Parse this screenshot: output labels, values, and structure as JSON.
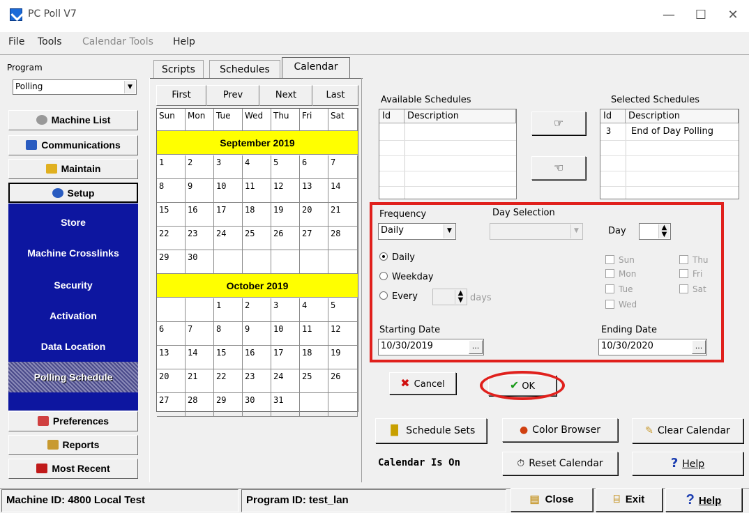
{
  "window": {
    "title": "PC Poll V7"
  },
  "menu": {
    "file": "File",
    "tools": "Tools",
    "calendar_tools": "Calendar Tools",
    "help": "Help"
  },
  "left_panel": {
    "program_label": "Program",
    "program_value": "Polling",
    "nav": {
      "machine_list": "Machine List",
      "communications": "Communications",
      "maintain": "Maintain",
      "setup": "Setup",
      "preferences": "Preferences",
      "reports": "Reports",
      "most_recent": "Most Recent"
    },
    "setup_items": [
      "Store",
      "Machine Crosslinks",
      "Security",
      "Activation",
      "Data Location",
      "Polling Schedule"
    ]
  },
  "tabs": {
    "scripts": "Scripts",
    "schedules": "Schedules",
    "calendar": "Calendar"
  },
  "calendar": {
    "nav": {
      "first": "First",
      "prev": "Prev",
      "next": "Next",
      "last": "Last"
    },
    "days": [
      "Sun",
      "Mon",
      "Tue",
      "Wed",
      "Thu",
      "Fri",
      "Sat"
    ],
    "months": [
      {
        "name": "September 2019",
        "weeks": [
          [
            "1",
            "2",
            "3",
            "4",
            "5",
            "6",
            "7"
          ],
          [
            "8",
            "9",
            "10",
            "11",
            "12",
            "13",
            "14"
          ],
          [
            "15",
            "16",
            "17",
            "18",
            "19",
            "20",
            "21"
          ],
          [
            "22",
            "23",
            "24",
            "25",
            "26",
            "27",
            "28"
          ],
          [
            "29",
            "30",
            "",
            "",
            "",
            "",
            ""
          ]
        ]
      },
      {
        "name": "October 2019",
        "weeks": [
          [
            "",
            "",
            "1",
            "2",
            "3",
            "4",
            "5"
          ],
          [
            "6",
            "7",
            "8",
            "9",
            "10",
            "11",
            "12"
          ],
          [
            "13",
            "14",
            "15",
            "16",
            "17",
            "18",
            "19"
          ],
          [
            "20",
            "21",
            "22",
            "23",
            "24",
            "25",
            "26"
          ],
          [
            "27",
            "28",
            "29",
            "30",
            "31",
            "",
            ""
          ]
        ]
      }
    ],
    "month_band_color": "#ffff00"
  },
  "available": {
    "label": "Available Schedules",
    "col_id": "Id",
    "col_desc": "Description",
    "rows": []
  },
  "selected": {
    "label": "Selected Schedules",
    "col_id": "Id",
    "col_desc": "Description",
    "rows": [
      {
        "id": "3",
        "desc": "End of Day Polling"
      }
    ]
  },
  "frequency": {
    "label": "Frequency",
    "value": "Daily",
    "day_selection_label": "Day Selection",
    "day_label": "Day",
    "opt_daily": "Daily",
    "opt_weekday": "Weekday",
    "opt_every": "Every",
    "days_suffix": "days",
    "weekdays": {
      "sun": "Sun",
      "mon": "Mon",
      "tue": "Tue",
      "wed": "Wed",
      "thu": "Thu",
      "fri": "Fri",
      "sat": "Sat"
    },
    "starting_label": "Starting Date",
    "starting_value": "10/30/2019",
    "ending_label": "Ending Date",
    "ending_value": "10/30/2020",
    "ellipsis": "..."
  },
  "buttons": {
    "cancel": "Cancel",
    "ok": "OK",
    "schedule_sets": "Schedule Sets",
    "color_browser": "Color Browser",
    "clear_calendar": "Clear Calendar",
    "reset_calendar": "Reset Calendar",
    "help": "Help",
    "close": "Close",
    "exit": "Exit"
  },
  "calendar_status": "Calendar Is On",
  "status_bar": {
    "machine_id": "Machine ID: 4800 Local Test",
    "program_id": "Program ID: test_lan"
  },
  "colors": {
    "nav_blue": "#0d16a0",
    "highlight_red": "#e0201c",
    "ok_green": "#1a9a1a"
  }
}
